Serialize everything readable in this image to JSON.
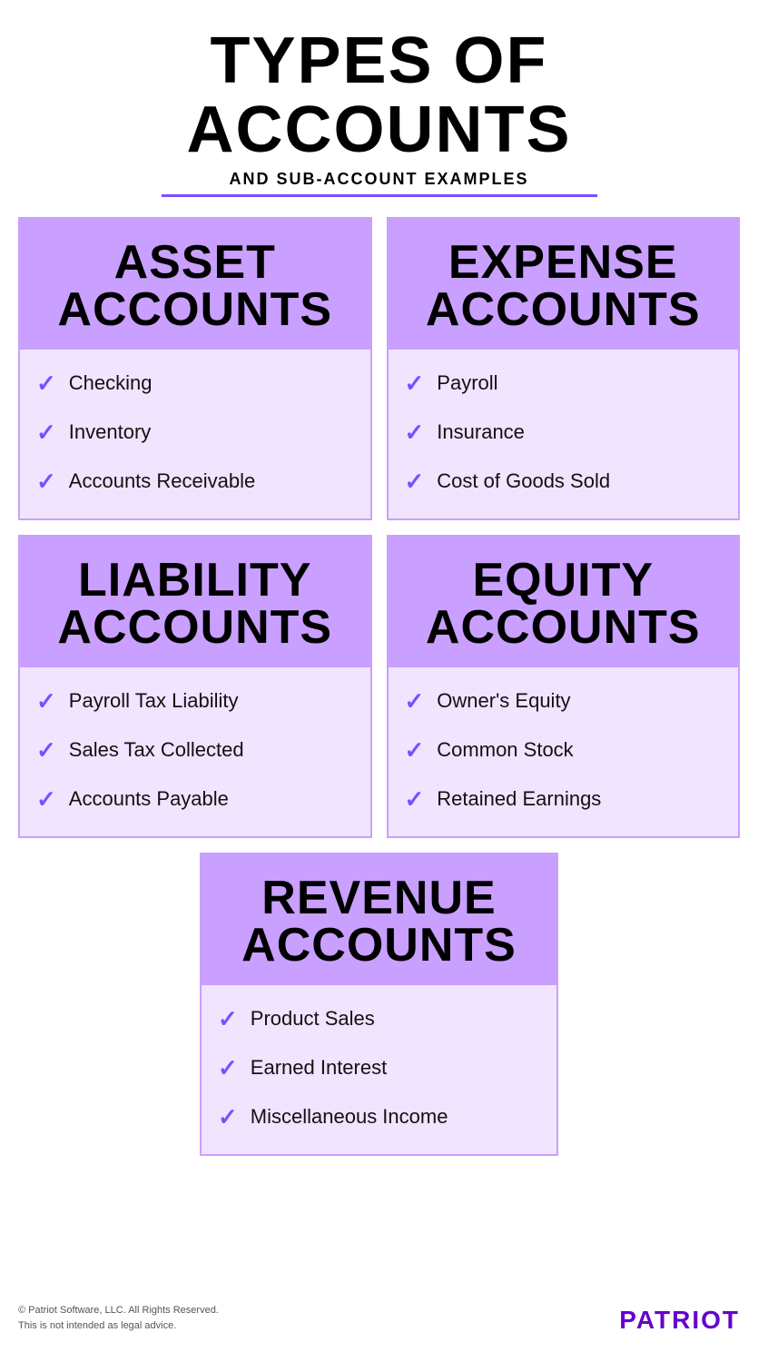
{
  "page": {
    "main_title": "TYPES OF ACCOUNTS",
    "subtitle": "AND SUB-ACCOUNT EXAMPLES"
  },
  "cards": [
    {
      "id": "asset",
      "title_line1": "ASSET",
      "title_line2": "ACCOUNTS",
      "items": [
        "Checking",
        "Inventory",
        "Accounts Receivable"
      ]
    },
    {
      "id": "expense",
      "title_line1": "EXPENSE",
      "title_line2": "ACCOUNTS",
      "items": [
        "Payroll",
        "Insurance",
        "Cost of Goods Sold"
      ]
    },
    {
      "id": "liability",
      "title_line1": "LIABILITY",
      "title_line2": "ACCOUNTS",
      "items": [
        "Payroll Tax Liability",
        "Sales Tax Collected",
        "Accounts Payable"
      ]
    },
    {
      "id": "equity",
      "title_line1": "EQUITY",
      "title_line2": "ACCOUNTS",
      "items": [
        "Owner's Equity",
        "Common Stock",
        "Retained Earnings"
      ]
    },
    {
      "id": "revenue",
      "title_line1": "REVENUE",
      "title_line2": "ACCOUNTS",
      "items": [
        "Product Sales",
        "Earned Interest",
        "Miscellaneous Income"
      ]
    }
  ],
  "footer": {
    "left_line1": "© Patriot Software, LLC. All Rights Reserved.",
    "left_line2": "This is not intended as legal advice.",
    "brand": "PATRIOT"
  },
  "checkmark": "✓"
}
